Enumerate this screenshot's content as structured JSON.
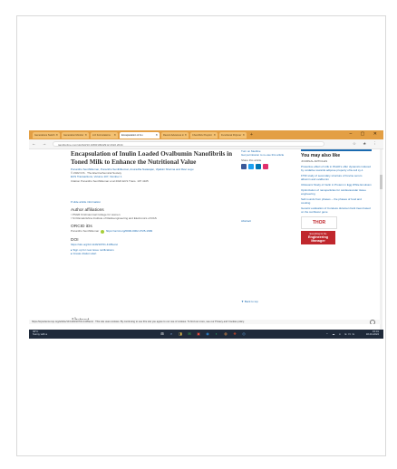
{
  "browser": {
    "tabs": [
      {
        "label": "Generations Switch"
      },
      {
        "label": "Generation Monitor"
      },
      {
        "label": "LCI Formulations"
      },
      {
        "label": "Encapsulation of Inu",
        "active": true
      },
      {
        "label": "Recent Advances in"
      },
      {
        "label": "ChemRxiv Preprint"
      },
      {
        "label": "Functional Polymer"
      }
    ],
    "new_tab": "+",
    "window_controls": "– ▢ ✕",
    "nav_controls": "← → C",
    "address": "tandfonline.com/doi/full/10.1080/10942912.2022.2044",
    "right_icons": "☆ ★ ⋮"
  },
  "article": {
    "title": "Encapsulation of Inulin Loaded Ovalbumin Nanofibrils in Toned Milk to Enhance the Nutritional Value",
    "authors": "Punanthu Senthilkumar, Punanthu Senthilkumar, Anuradha Natarajan, Vijaikini Sharma and Ravi Logu",
    "date": "© 2022 ICS · The Electrochemical Society",
    "journal": "ECS Transactions, Volume 107, Number 1",
    "citation": "Citation Punanthu Senthilkumar et al 2022 ECS Trans. 107 4105",
    "hide_info": "▾ Hide article information",
    "affiliations_heading": "Author affiliations",
    "affiliation_1": "¹ PSGR Krishnammal College for women",
    "affiliation_2": "² Sri Ramakrishna Institute of Radioengineering and Electronics of RAS",
    "orcid_heading": "ORCID iDs",
    "orcid_text": "Punanthu Senthilkumar",
    "orcid_link": "https://orcid.org/0000-0002-3725-1999",
    "doi_heading": "DOI",
    "doi_link": "https://doi.org/10.1149/10701.4105ecst",
    "signup": "▸ Sign up for new issue notifications",
    "citation_alert": "▸ Create citation alert",
    "abstract_heading": "Abstract"
  },
  "actions": {
    "permissions": "Turn on Medline",
    "get_permission": "Get permission to re-use this article",
    "share": "Share this article",
    "share_colors": [
      "#3b5998",
      "#1da1f2",
      "#0077b5",
      "#e1306c"
    ],
    "abstract_label": "Abstract",
    "back_to_top": "▼ Back to top"
  },
  "sidebar": {
    "you_may_like": "You may also like",
    "journal_articles": "JOURNAL ARTICLES",
    "related": [
      "Protective effect of milk in PAHO's offer dynamics induced by oxidative towards adipose property of E-cell cy-1",
      "FTIR study of secondary structure of bovine serum albumin and ovalbumin",
      "Ultrasonic Study of Inulin in Protein in Egg White Emulsion",
      "Optimization of nanoparticles for cardiovascular tissue engineering",
      "Self-rounds from phases -- the phases of food and cooking",
      "Genetic evaluation of Cureless duramen bark trees based on the sunflower gene"
    ],
    "ad_thor": "THOR",
    "ad_eng_1": "Everything for the",
    "ad_eng_2": "Engineering Manager"
  },
  "cookie": {
    "text": "https://iopscience.iop.org/article/10.1149/10701.4105ecst · This site uses cookies. By continuing to use this site you agree to our use of cookies. To find out more, see our Privacy and Cookies policy.",
    "ok": "⊗"
  },
  "taskbar": {
    "weather_temp": "30°C",
    "weather_text": "Sunny with a",
    "icons": [
      "⊞",
      "⌕",
      "◨",
      "✉",
      "▣",
      "◉",
      "◐",
      "◍",
      "❖",
      "◎"
    ],
    "icon_colors": [
      "#ffffff",
      "#7aa7e0",
      "#f2c94c",
      "#3ab54a",
      "#e84b3c",
      "#2b88d8",
      "#27ae60",
      "#f2994a",
      "#d24726",
      "#5b9bd5"
    ],
    "sys": "^ ☁ ⏸ ENG",
    "time": "15:01",
    "date": "18-04-2022"
  }
}
